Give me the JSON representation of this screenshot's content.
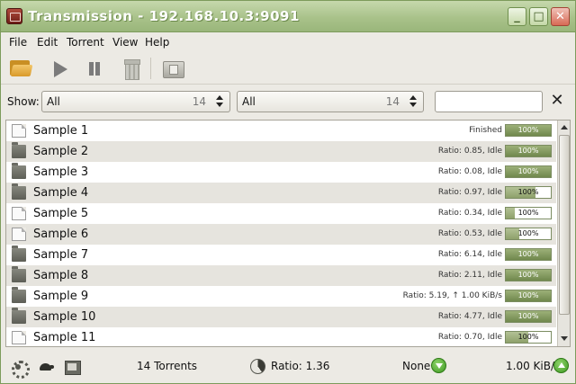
{
  "window": {
    "title": "Transmission - 192.168.10.3:9091"
  },
  "menu": {
    "items": [
      "File",
      "Edit",
      "Torrent",
      "View",
      "Help"
    ]
  },
  "toolbar": {
    "open_icon": "folder-open-icon",
    "start_icon": "play-icon",
    "pause_icon": "pause-icon",
    "remove_icon": "trash-icon",
    "properties_icon": "properties-icon"
  },
  "filter": {
    "show_label": "Show:",
    "state_filter": {
      "value": "All",
      "count": "14"
    },
    "tracker_filter": {
      "value": "All",
      "count": "14"
    },
    "search": {
      "value": ""
    },
    "clear_label": "✕"
  },
  "torrents": [
    {
      "name": "Sample 1",
      "type": "file",
      "status": "Finished",
      "progress": 100,
      "progress_label": "100%"
    },
    {
      "name": "Sample 2",
      "type": "folder",
      "status": "Ratio: 0.85, Idle",
      "progress": 100,
      "progress_label": "100%"
    },
    {
      "name": "Sample 3",
      "type": "folder",
      "status": "Ratio: 0.08, Idle",
      "progress": 100,
      "progress_label": "100%"
    },
    {
      "name": "Sample 4",
      "type": "folder",
      "status": "Ratio: 0.97, Idle",
      "progress": 65,
      "progress_label": "100%"
    },
    {
      "name": "Sample 5",
      "type": "file",
      "status": "Ratio: 0.34, Idle",
      "progress": 20,
      "progress_label": "100%"
    },
    {
      "name": "Sample 6",
      "type": "file",
      "status": "Ratio: 0.53, Idle",
      "progress": 30,
      "progress_label": "100%"
    },
    {
      "name": "Sample 7",
      "type": "folder",
      "status": "Ratio: 6.14, Idle",
      "progress": 100,
      "progress_label": "100%"
    },
    {
      "name": "Sample 8",
      "type": "folder",
      "status": "Ratio: 2.11, Idle",
      "progress": 100,
      "progress_label": "100%"
    },
    {
      "name": "Sample 9",
      "type": "folder",
      "status": "Ratio: 5.19, ↑ 1.00 KiB/s",
      "progress": 100,
      "progress_label": "100%"
    },
    {
      "name": "Sample 10",
      "type": "folder",
      "status": "Ratio: 4.77, Idle",
      "progress": 100,
      "progress_label": "100%"
    },
    {
      "name": "Sample 11",
      "type": "file",
      "status": "Ratio: 0.70, Idle",
      "progress": 50,
      "progress_label": "100%"
    }
  ],
  "statusbar": {
    "torrent_count": "14 Torrents",
    "ratio": "Ratio: 1.36",
    "download_speed": "None",
    "upload_speed": "1.00 KiB/s"
  },
  "colors": {
    "accent": "#9ab67b",
    "progress": "#70884d"
  }
}
